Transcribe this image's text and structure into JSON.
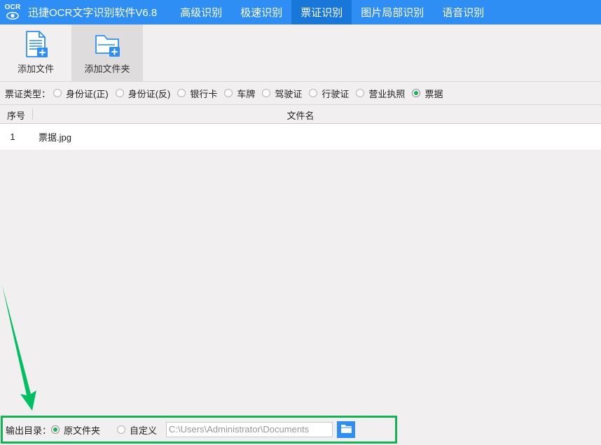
{
  "titlebar": {
    "logo_text": "OCR",
    "logo_icon": "eye-icon",
    "app_title": "迅捷OCR文字识别软件V6.8",
    "accent_color": "#2f8ef4",
    "active_tab_color": "#1877d8",
    "tabs": [
      {
        "label": "高级识别",
        "active": false
      },
      {
        "label": "极速识别",
        "active": false
      },
      {
        "label": "票证识别",
        "active": true
      },
      {
        "label": "图片局部识别",
        "active": false
      },
      {
        "label": "语音识别",
        "active": false
      }
    ]
  },
  "toolbar": {
    "buttons": [
      {
        "label": "添加文件",
        "icon": "add-file-icon",
        "hover": false
      },
      {
        "label": "添加文件夹",
        "icon": "add-folder-icon",
        "hover": true
      }
    ]
  },
  "type_row": {
    "label": "票证类型：",
    "options": [
      {
        "label": "身份证(正)",
        "checked": false
      },
      {
        "label": "身份证(反)",
        "checked": false
      },
      {
        "label": "银行卡",
        "checked": false
      },
      {
        "label": "车牌",
        "checked": false
      },
      {
        "label": "驾驶证",
        "checked": false
      },
      {
        "label": "行驶证",
        "checked": false
      },
      {
        "label": "营业执照",
        "checked": false
      },
      {
        "label": "票据",
        "checked": true
      }
    ],
    "selected_color": "#14b456"
  },
  "file_table": {
    "columns": {
      "index": "序号",
      "name": "文件名"
    },
    "rows": [
      {
        "index": "1",
        "name": "票据.jpg"
      }
    ]
  },
  "annotation": {
    "arrow_color": "#00bf63",
    "highlight_color": "#14b456"
  },
  "bottom_bar": {
    "label": "输出目录：",
    "options": [
      {
        "label": "原文件夹",
        "checked": true
      },
      {
        "label": "自定义",
        "checked": false
      }
    ],
    "path_value": "C:\\Users\\Administrator\\Documents",
    "path_placeholder": "C:\\Users\\Administrator\\Documents",
    "browse_icon": "folder-icon"
  }
}
